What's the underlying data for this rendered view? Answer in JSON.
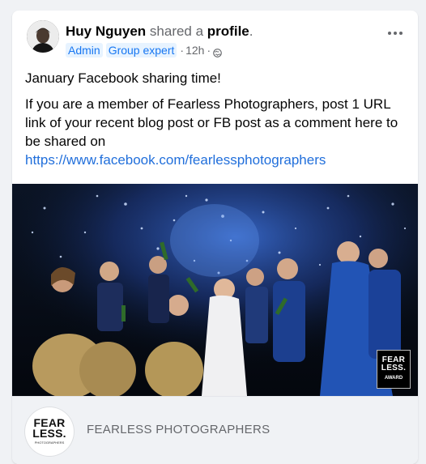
{
  "post": {
    "author_name": "Huy Nguyen",
    "action_text": " shared a ",
    "object_text": "profile",
    "period": ".",
    "badges": [
      "Admin",
      "Group expert"
    ],
    "badge_separator": "·",
    "time": "12h",
    "time_separator": "·",
    "audience_icon": "globe-icon",
    "more_icon": "more-horizontal-icon",
    "paragraphs": [
      "January Facebook sharing time!",
      "If you are a member of Fearless Photographers, post 1 URL link of your recent blog post or FB post as a comment here to be shared on"
    ],
    "link": "https://www.facebook.com/fearlessphotographers"
  },
  "photo": {
    "description_icon": "wedding-party-photo",
    "badge_lines": [
      "FEAR",
      "LESS.",
      "AWARD"
    ]
  },
  "preview": {
    "logo_lines": [
      "FEAR",
      "LESS.",
      "PHOTOGRAPHERS"
    ],
    "title": "FEARLESS PHOTOGRAPHERS"
  },
  "colors": {
    "link": "#216fdb",
    "badge_bg": "#e7f3ff",
    "badge_text": "#1877f2",
    "secondary_text": "#65676b"
  }
}
